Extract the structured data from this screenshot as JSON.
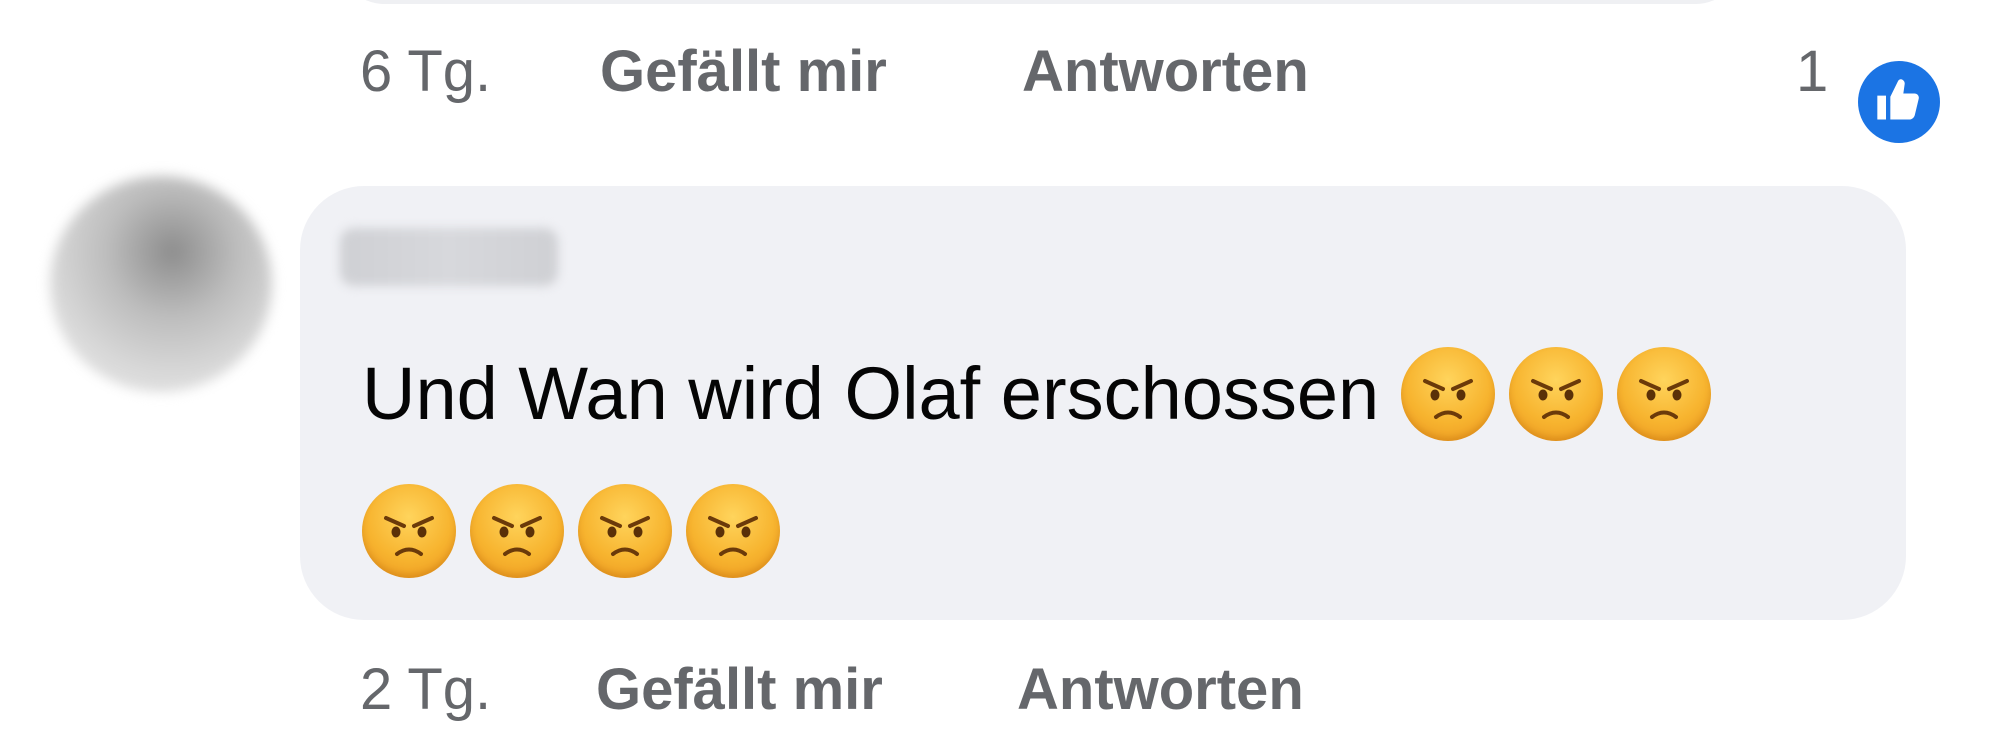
{
  "comments": [
    {
      "time": "6 Tg.",
      "like_label": "Gefällt mir",
      "reply_label": "Antworten",
      "reaction_count": "1",
      "reaction_icon": "thumbs-up-icon"
    },
    {
      "author": "",
      "text": "Und Wan wird Olaf erschossen",
      "emoji_name": "angry-face-emoji",
      "emoji_count": 7,
      "time": "2 Tg.",
      "like_label": "Gefällt mir",
      "reply_label": "Antworten"
    }
  ],
  "colors": {
    "bubble_background": "#f0f1f5",
    "meta_text": "#65676b",
    "like_blue": "#1b74e4"
  }
}
